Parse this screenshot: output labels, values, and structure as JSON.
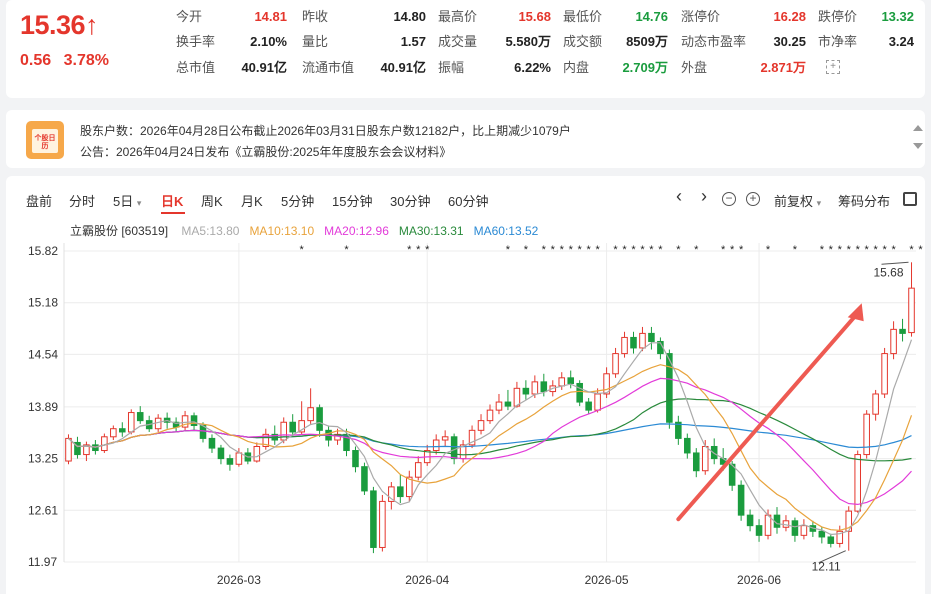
{
  "quote": {
    "price": "15.36↑",
    "change": "0.56",
    "change_pct": "3.78%",
    "rows": [
      [
        {
          "label": "今开",
          "value": "14.81",
          "color": "red"
        },
        {
          "label": "昨收",
          "value": "14.80",
          "color": "normal"
        },
        {
          "label": "最高价",
          "value": "15.68",
          "color": "red"
        },
        {
          "label": "最低价",
          "value": "14.76",
          "color": "green"
        },
        {
          "label": "涨停价",
          "value": "16.28",
          "color": "red"
        },
        {
          "label": "跌停价",
          "value": "13.32",
          "color": "green"
        }
      ],
      [
        {
          "label": "换手率",
          "value": "2.10%",
          "color": "normal"
        },
        {
          "label": "量比",
          "value": "1.57",
          "color": "normal"
        },
        {
          "label": "成交量",
          "value": "5.580万",
          "color": "normal"
        },
        {
          "label": "成交额",
          "value": "8509万",
          "color": "normal"
        },
        {
          "label": "动态市盈率",
          "value": "30.25",
          "color": "normal"
        },
        {
          "label": "市净率",
          "value": "3.24",
          "color": "normal"
        }
      ],
      [
        {
          "label": "总市值",
          "value": "40.91亿",
          "color": "normal"
        },
        {
          "label": "流通市值",
          "value": "40.91亿",
          "color": "normal"
        },
        {
          "label": "振幅",
          "value": "6.22%",
          "color": "normal"
        },
        {
          "label": "内盘",
          "value": "2.709万",
          "color": "green"
        },
        {
          "label": "外盘",
          "value": "2.871万",
          "color": "red"
        }
      ]
    ]
  },
  "notice": {
    "logo_text": "个股日历",
    "line1": "股东户数：2026年04月28日公布截止2026年03月31日股东户数12182户，比上期减少1079户",
    "line2": "公告：2026年04月24日发布《立霸股份:2025年年度股东会会议材料》"
  },
  "tabs": [
    "盘前",
    "分时",
    "5日",
    "日K",
    "周K",
    "月K",
    "5分钟",
    "15分钟",
    "30分钟",
    "60分钟"
  ],
  "tab_dropdown": "▾",
  "tools": {
    "prev": "‹",
    "next": "›",
    "zoom_out": "−",
    "zoom_in": "+",
    "adjust": "前复权",
    "adjust_arrow": "▾",
    "chips": "筹码分布"
  },
  "legend": {
    "stock": "立霸股份 [603519]",
    "ma": [
      {
        "text": "MA5:13.80",
        "color": "#aaaaaa"
      },
      {
        "text": "MA10:13.10",
        "color": "#e8a33c"
      },
      {
        "text": "MA20:12.96",
        "color": "#e23bd9"
      },
      {
        "text": "MA30:13.31",
        "color": "#2a8a3c"
      },
      {
        "text": "MA60:13.52",
        "color": "#2b8ad4"
      }
    ]
  },
  "colors": {
    "up": "#e4362c",
    "down": "#1a9c3e",
    "ma5": "#aaaaaa",
    "ma10": "#e8a33c",
    "ma20": "#e23bd9",
    "ma30": "#2a8a3c",
    "ma60": "#2b8ad4"
  },
  "chart_data": {
    "type": "candlestick",
    "y_ticks": [
      "15.82",
      "15.18",
      "14.54",
      "13.89",
      "13.25",
      "12.61",
      "11.97"
    ],
    "ylim": [
      11.97,
      15.82
    ],
    "x_ticks": [
      {
        "label": "2026-03",
        "index": 19
      },
      {
        "label": "2026-04",
        "index": 40
      },
      {
        "label": "2026-05",
        "index": 60
      },
      {
        "label": "2026-06",
        "index": 77
      }
    ],
    "annotations": [
      {
        "text": "15.68",
        "index": 94,
        "value": 15.68
      },
      {
        "text": "12.11",
        "index": 87,
        "value": 12.11
      }
    ],
    "candles": [
      [
        13.22,
        13.5,
        13.55,
        13.18
      ],
      [
        13.45,
        13.3,
        13.52,
        13.25
      ],
      [
        13.3,
        13.42,
        13.46,
        13.22
      ],
      [
        13.42,
        13.35,
        13.48,
        13.3
      ],
      [
        13.35,
        13.52,
        13.56,
        13.32
      ],
      [
        13.52,
        13.62,
        13.66,
        13.48
      ],
      [
        13.62,
        13.58,
        13.7,
        13.52
      ],
      [
        13.58,
        13.82,
        13.86,
        13.55
      ],
      [
        13.82,
        13.72,
        13.9,
        13.68
      ],
      [
        13.72,
        13.62,
        13.78,
        13.58
      ],
      [
        13.62,
        13.75,
        13.8,
        13.58
      ],
      [
        13.75,
        13.7,
        13.82,
        13.62
      ],
      [
        13.7,
        13.64,
        13.76,
        13.58
      ],
      [
        13.64,
        13.78,
        13.84,
        13.6
      ],
      [
        13.78,
        13.66,
        13.82,
        13.6
      ],
      [
        13.66,
        13.5,
        13.7,
        13.45
      ],
      [
        13.5,
        13.38,
        13.55,
        13.32
      ],
      [
        13.38,
        13.25,
        13.42,
        13.18
      ],
      [
        13.25,
        13.18,
        13.3,
        13.1
      ],
      [
        13.18,
        13.32,
        13.38,
        13.15
      ],
      [
        13.32,
        13.22,
        13.38,
        13.18
      ],
      [
        13.22,
        13.4,
        13.45,
        13.2
      ],
      [
        13.4,
        13.55,
        13.62,
        13.36
      ],
      [
        13.55,
        13.48,
        13.66,
        13.42
      ],
      [
        13.48,
        13.7,
        13.76,
        13.44
      ],
      [
        13.7,
        13.58,
        13.8,
        13.52
      ],
      [
        13.58,
        13.72,
        13.96,
        13.55
      ],
      [
        13.72,
        13.88,
        14.12,
        13.68
      ],
      [
        13.88,
        13.6,
        13.92,
        13.52
      ],
      [
        13.6,
        13.48,
        13.66,
        13.4
      ],
      [
        13.48,
        13.55,
        13.62,
        13.42
      ],
      [
        13.55,
        13.35,
        13.62,
        13.28
      ],
      [
        13.35,
        13.15,
        13.4,
        13.08
      ],
      [
        13.15,
        12.85,
        13.2,
        12.8
      ],
      [
        12.85,
        12.15,
        12.9,
        12.08
      ],
      [
        12.15,
        12.72,
        12.8,
        12.1
      ],
      [
        12.72,
        12.9,
        12.96,
        12.62
      ],
      [
        12.9,
        12.78,
        13.05,
        12.7
      ],
      [
        12.78,
        13.02,
        13.1,
        12.72
      ],
      [
        13.02,
        13.2,
        13.28,
        12.98
      ],
      [
        13.2,
        13.35,
        13.42,
        13.16
      ],
      [
        13.35,
        13.48,
        13.55,
        13.3
      ],
      [
        13.48,
        13.52,
        13.6,
        13.4
      ],
      [
        13.52,
        13.25,
        13.56,
        13.18
      ],
      [
        13.25,
        13.42,
        13.48,
        13.2
      ],
      [
        13.42,
        13.6,
        13.66,
        13.38
      ],
      [
        13.6,
        13.72,
        13.8,
        13.55
      ],
      [
        13.72,
        13.85,
        13.92,
        13.68
      ],
      [
        13.85,
        13.95,
        14.05,
        13.8
      ],
      [
        13.95,
        13.9,
        14.1,
        13.85
      ],
      [
        13.9,
        14.12,
        14.2,
        13.88
      ],
      [
        14.12,
        14.05,
        14.22,
        13.98
      ],
      [
        14.05,
        14.2,
        14.28,
        14.0
      ],
      [
        14.2,
        14.08,
        14.3,
        14.02
      ],
      [
        14.08,
        14.15,
        14.22,
        14.02
      ],
      [
        14.15,
        14.25,
        14.32,
        14.1
      ],
      [
        14.25,
        14.18,
        14.34,
        14.12
      ],
      [
        14.18,
        13.95,
        14.22,
        13.9
      ],
      [
        13.95,
        13.85,
        14.0,
        13.8
      ],
      [
        13.85,
        14.05,
        14.12,
        13.82
      ],
      [
        14.05,
        14.3,
        14.38,
        14.0
      ],
      [
        14.3,
        14.55,
        14.62,
        14.25
      ],
      [
        14.55,
        14.75,
        14.82,
        14.5
      ],
      [
        14.75,
        14.62,
        14.82,
        14.55
      ],
      [
        14.62,
        14.8,
        14.88,
        14.58
      ],
      [
        14.8,
        14.7,
        14.88,
        14.6
      ],
      [
        14.7,
        14.55,
        14.75,
        14.48
      ],
      [
        14.55,
        13.7,
        14.6,
        13.62
      ],
      [
        13.7,
        13.5,
        13.78,
        13.42
      ],
      [
        13.5,
        13.32,
        13.56,
        13.25
      ],
      [
        13.32,
        13.1,
        13.38,
        13.02
      ],
      [
        13.1,
        13.4,
        13.48,
        13.05
      ],
      [
        13.4,
        13.25,
        13.5,
        13.18
      ],
      [
        13.25,
        13.18,
        13.38,
        13.1
      ],
      [
        13.18,
        12.92,
        13.22,
        12.85
      ],
      [
        12.92,
        12.55,
        12.98,
        12.48
      ],
      [
        12.55,
        12.42,
        12.62,
        12.35
      ],
      [
        12.42,
        12.3,
        12.5,
        12.22
      ],
      [
        12.3,
        12.55,
        12.62,
        12.25
      ],
      [
        12.55,
        12.4,
        12.65,
        12.32
      ],
      [
        12.4,
        12.48,
        12.55,
        12.35
      ],
      [
        12.48,
        12.3,
        12.52,
        12.22
      ],
      [
        12.3,
        12.42,
        12.5,
        12.25
      ],
      [
        12.42,
        12.35,
        12.48,
        12.28
      ],
      [
        12.35,
        12.28,
        12.4,
        12.2
      ],
      [
        12.28,
        12.2,
        12.32,
        12.15
      ],
      [
        12.2,
        12.35,
        12.42,
        12.15
      ],
      [
        12.35,
        12.6,
        12.66,
        12.11
      ],
      [
        12.6,
        13.3,
        13.35,
        12.58
      ],
      [
        13.3,
        13.8,
        13.85,
        13.25
      ],
      [
        13.8,
        14.05,
        14.1,
        13.72
      ],
      [
        14.05,
        14.55,
        14.62,
        14.0
      ],
      [
        14.55,
        14.85,
        14.95,
        14.48
      ],
      [
        14.85,
        14.8,
        14.98,
        14.7
      ],
      [
        14.81,
        15.36,
        15.68,
        14.76
      ]
    ]
  }
}
